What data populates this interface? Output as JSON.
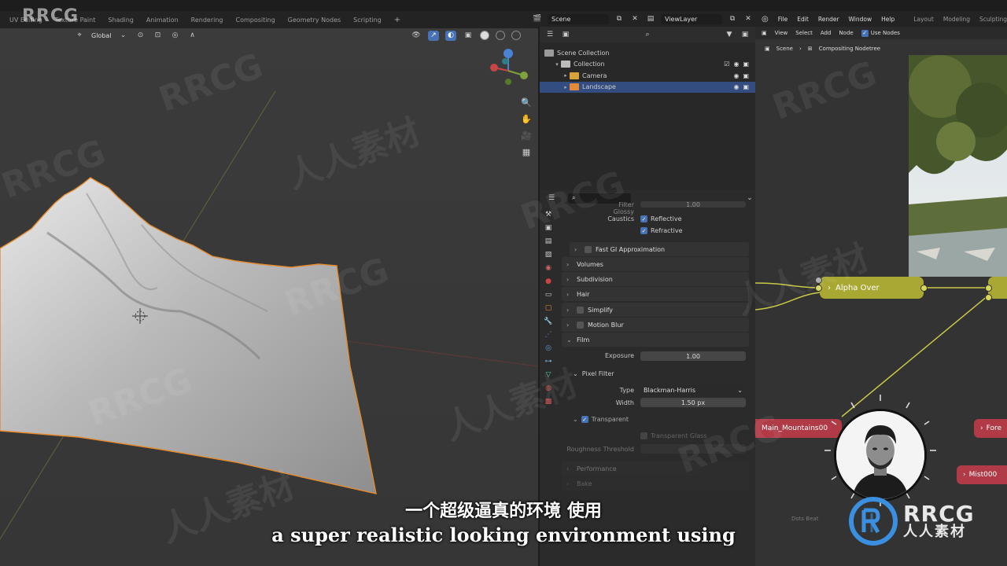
{
  "watermark": {
    "logo_text": "RRCG",
    "brand_main": "RRCG",
    "brand_sub": "人人素材",
    "repeat_latin": "RRCG",
    "repeat_cjk": "人人素材"
  },
  "workspace_tabs": [
    "UV Editing",
    "Texture Paint",
    "Shading",
    "Animation",
    "Rendering",
    "Compositing",
    "Geometry Nodes",
    "Scripting",
    "+"
  ],
  "viewport": {
    "transform_orientation": "Global",
    "icons": [
      "globe-icon",
      "pivot-icon",
      "snap-icon",
      "proportional-icon"
    ]
  },
  "scene_bar": {
    "scene": "Scene",
    "view_layer": "ViewLayer"
  },
  "outliner": {
    "rows": [
      {
        "label": "Scene Collection",
        "indent": 0,
        "icon": "#9a9a9a",
        "selected": false
      },
      {
        "label": "Collection",
        "indent": 1,
        "icon": "#bbbbbb",
        "selected": false
      },
      {
        "label": "Camera",
        "indent": 2,
        "icon": "#d8a23a",
        "selected": false
      },
      {
        "label": "Landscape",
        "indent": 2,
        "icon": "#e08a3a",
        "selected": true
      }
    ]
  },
  "properties": {
    "cut_label": "Filter Glossy",
    "cut_value": "1.00",
    "caustics_label": "Caustics",
    "reflective": "Reflective",
    "refractive": "Refractive",
    "fast_gi": "Fast GI Approximation",
    "sections": [
      "Volumes",
      "Subdivision",
      "Hair",
      "Simplify",
      "Motion Blur",
      "Film"
    ],
    "exposure_label": "Exposure",
    "exposure_value": "1.00",
    "pixel_filter": "Pixel Filter",
    "type_label": "Type",
    "type_value": "Blackman-Harris",
    "width_label": "Width",
    "width_value": "1.50 px",
    "transparent": "Transparent",
    "transparent_glass": "Transparent Glass",
    "roughness_label": "Roughness Threshold",
    "performance": "Performance",
    "bake": "Bake"
  },
  "node_editor": {
    "menus": [
      "File",
      "Edit",
      "Render",
      "Window",
      "Help",
      "Layout",
      "Modeling",
      "Sculpting"
    ],
    "header_items": [
      "View",
      "Select",
      "Add",
      "Node"
    ],
    "use_nodes": "Use Nodes",
    "breadcrumb": [
      "Scene",
      "Compositing Nodetree"
    ],
    "alpha_over": "Alpha Over",
    "main_mountains": "Main_Mountains00",
    "fore": "Fore",
    "mist": "Mist000",
    "node_color": "#a8a832",
    "footer": "Dots Beat"
  },
  "subtitles": {
    "zh": "一个超级逼真的环境 使用",
    "en": "a super realistic looking environment using"
  }
}
